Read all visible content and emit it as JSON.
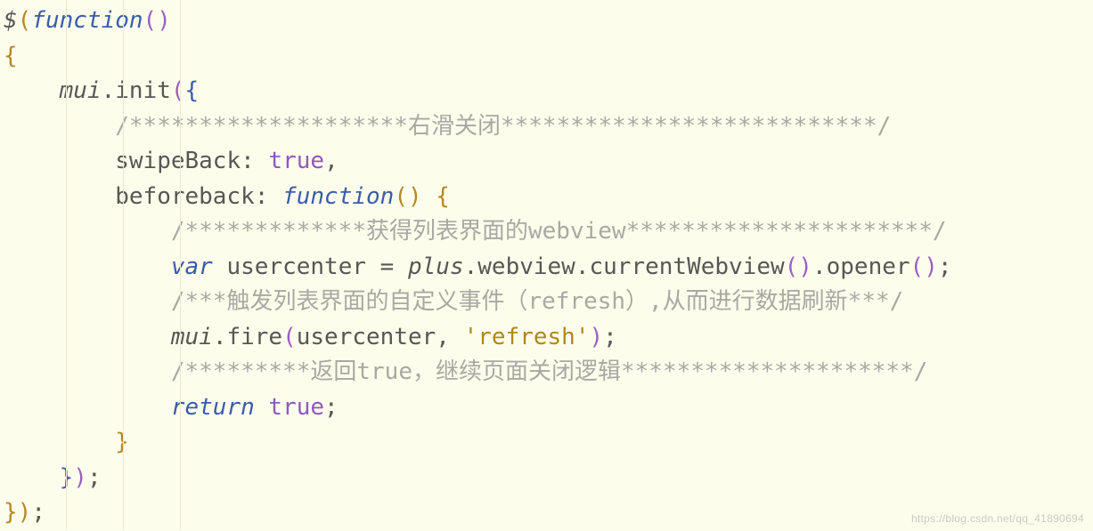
{
  "code": {
    "l1": {
      "dollar": "$",
      "p1": "(",
      "fn": "function",
      "p2": "(",
      "p3": ")"
    },
    "l2": {
      "brace": "{"
    },
    "l3": {
      "indent": "    ",
      "obj": "mui",
      "dot": ".",
      "call": "init",
      "p1": "(",
      "brace": "{"
    },
    "l4": {
      "indent": "        ",
      "comment": "/********************右滑关闭***************************/"
    },
    "l5": {
      "indent": "        ",
      "key": "swipeBack",
      "colon": ": ",
      "val": "true",
      "comma": ","
    },
    "l6": {
      "indent": "        ",
      "key": "beforeback",
      "colon": ": ",
      "fn": "function",
      "p1": "(",
      "p2": ")",
      "sp": " ",
      "brace": "{"
    },
    "l7": {
      "indent": "            ",
      "comment": "/*************获得列表界面的webview**********************/"
    },
    "l8": {
      "indent": "            ",
      "var": "var",
      "sp": " ",
      "name": "usercenter",
      "eq": " = ",
      "obj": "plus",
      "rest": ".webview.currentWebview",
      "p1": "(",
      "p2": ")",
      "dot": ".",
      "call2": "opener",
      "p3": "(",
      "p4": ")",
      "semi": ";"
    },
    "l9": {
      "indent": "            ",
      "comment": "/***触发列表界面的自定义事件（refresh）,从而进行数据刷新***/"
    },
    "l10": {
      "indent": "            ",
      "obj": "mui",
      "rest": ".fire",
      "p1": "(",
      "arg1": "usercenter",
      "comma": ", ",
      "str": "'refresh'",
      "p2": ")",
      "semi": ";"
    },
    "l11": {
      "indent": "            ",
      "comment": "/*********返回true，继续页面关闭逻辑*********************/"
    },
    "l12": {
      "indent": "            ",
      "ret": "return",
      "sp": " ",
      "val": "true",
      "semi": ";"
    },
    "l13": {
      "indent": "        ",
      "brace": "}"
    },
    "l14": {
      "indent": "    ",
      "brace": "}",
      "p": ")",
      "semi": ";"
    },
    "l15": {
      "brace": "}",
      "p": ")",
      "semi": ";"
    }
  },
  "watermark": "https://blog.csdn.net/qq_41890694"
}
